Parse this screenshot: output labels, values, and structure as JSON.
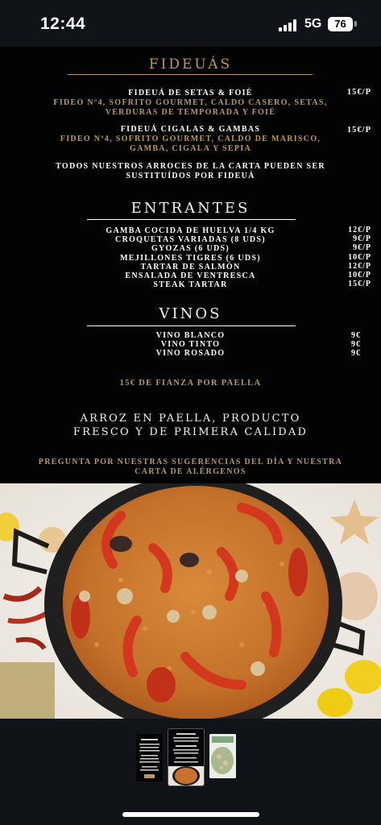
{
  "status_bar": {
    "time": "12:44",
    "network": "5G",
    "battery": "76"
  },
  "menu": {
    "fideuas": {
      "title": "FIDEUÁS",
      "items": [
        {
          "name": "FIDEUÁ DE SETAS & FOIÉ",
          "price": "15€/P",
          "desc_lines": [
            "FIDEO Nº4, SOFRITO GOURMET, CALDO CASERO, SETAS,",
            "VERDURAS DE TEMPORADA Y FOIÉ"
          ]
        },
        {
          "name": "FIDEUÁ CIGALAS & GAMBAS",
          "price": "15€/P",
          "desc_lines": [
            "FIDEO Nº4, SOFRITO GOURMET, CALDO DE MARISCO,",
            "GAMBA, CIGALA Y SEPIA"
          ]
        }
      ],
      "note_lines": [
        "TODOS NUESTROS ARROCES DE LA CARTA PUEDEN SER",
        "SUSTITUÍDOS POR FIDEUÁ"
      ]
    },
    "entrantes": {
      "title": "ENTRANTES",
      "items": [
        {
          "name": "GAMBA COCIDA DE HUELVA 1/4 KG",
          "price": "12€/P"
        },
        {
          "name": "CROQUETAS VARIADAS (8 UDS)",
          "price": "9€/P"
        },
        {
          "name": "GYOZAS (6 UDS)",
          "price": "9€/P"
        },
        {
          "name": "MEJILLONES TIGRES (6 UDS)",
          "price": "10€/P"
        },
        {
          "name": "TARTAR DE SALMÓN",
          "price": "12€/P"
        },
        {
          "name": "ENSALADA DE VENTRESCA",
          "price": "10€/P"
        },
        {
          "name": "STEAK TARTAR",
          "price": "15€/P"
        }
      ]
    },
    "vinos": {
      "title": "VINOS",
      "items": [
        {
          "name": "VINO BLANCO",
          "price": "9€"
        },
        {
          "name": "VINO TINTO",
          "price": "9€"
        },
        {
          "name": "VINO ROSADO",
          "price": "9€"
        }
      ]
    },
    "deposit": "15€ DE FIANZA POR PAELLA",
    "tagline_lines": [
      "ARROZ EN PAELLA, PRODUCTO",
      "FRESCO Y DE PRIMERA CALIDAD"
    ],
    "suggestion_lines": [
      "PREGUNTA POR NUESTRAS SUGERENCIAS DEL DÍA Y NUESTRA",
      "CARTA DE ALÉRGENOS"
    ]
  },
  "gallery": {
    "selected_index": 1,
    "count": 3
  },
  "colors": {
    "gold": "#b89a5c",
    "menu_bg": "#030303",
    "app_bg": "#101419"
  }
}
